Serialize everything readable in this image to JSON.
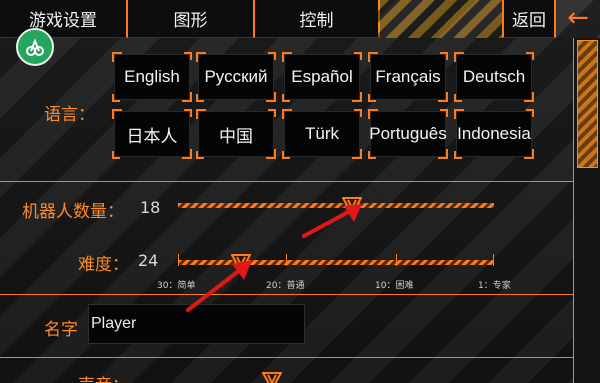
{
  "tabs": [
    {
      "label": "游戏设置"
    },
    {
      "label": "图形"
    },
    {
      "label": "控制"
    },
    {
      "label": "返回"
    }
  ],
  "language": {
    "label": "语言：",
    "options": [
      "English",
      "Русский",
      "Español",
      "Français",
      "Deutsch",
      "日本人",
      "中国",
      "Türk",
      "Português",
      "Indonesia"
    ]
  },
  "bots": {
    "label": "机器人数量：",
    "value": "18",
    "level": 0.55
  },
  "difficulty": {
    "label": "难度：",
    "value": "24",
    "level": 0.2,
    "ticks": [
      "30：简单",
      "20：普通",
      "10：困难",
      "1：专家"
    ]
  },
  "name": {
    "label": "名字",
    "value": "Player"
  },
  "sound": {
    "label": "声音："
  },
  "colors": {
    "accent": "#ff7a1a",
    "arrow": "#e01818",
    "logo": "#25a55f"
  },
  "icons": [
    "back-arrow-icon",
    "app-logo-icon",
    "slider-handle-icon"
  ]
}
